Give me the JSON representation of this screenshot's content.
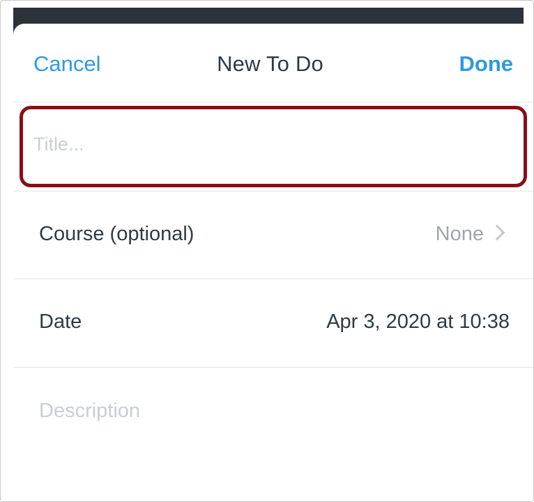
{
  "nav": {
    "cancel_label": "Cancel",
    "title": "New To Do",
    "done_label": "Done"
  },
  "title_field": {
    "value": "",
    "placeholder": "Title..."
  },
  "course_row": {
    "label": "Course (optional)",
    "value": "None",
    "icon": "chevron-right-icon"
  },
  "date_row": {
    "label": "Date",
    "value": "Apr 3, 2020 at 10:38"
  },
  "description_field": {
    "value": "",
    "placeholder": "Description"
  },
  "colors": {
    "accent": "#2d9ae3",
    "highlight_border": "#8b0d16",
    "text": "#2d3b45",
    "muted": "#9ea6ad"
  }
}
